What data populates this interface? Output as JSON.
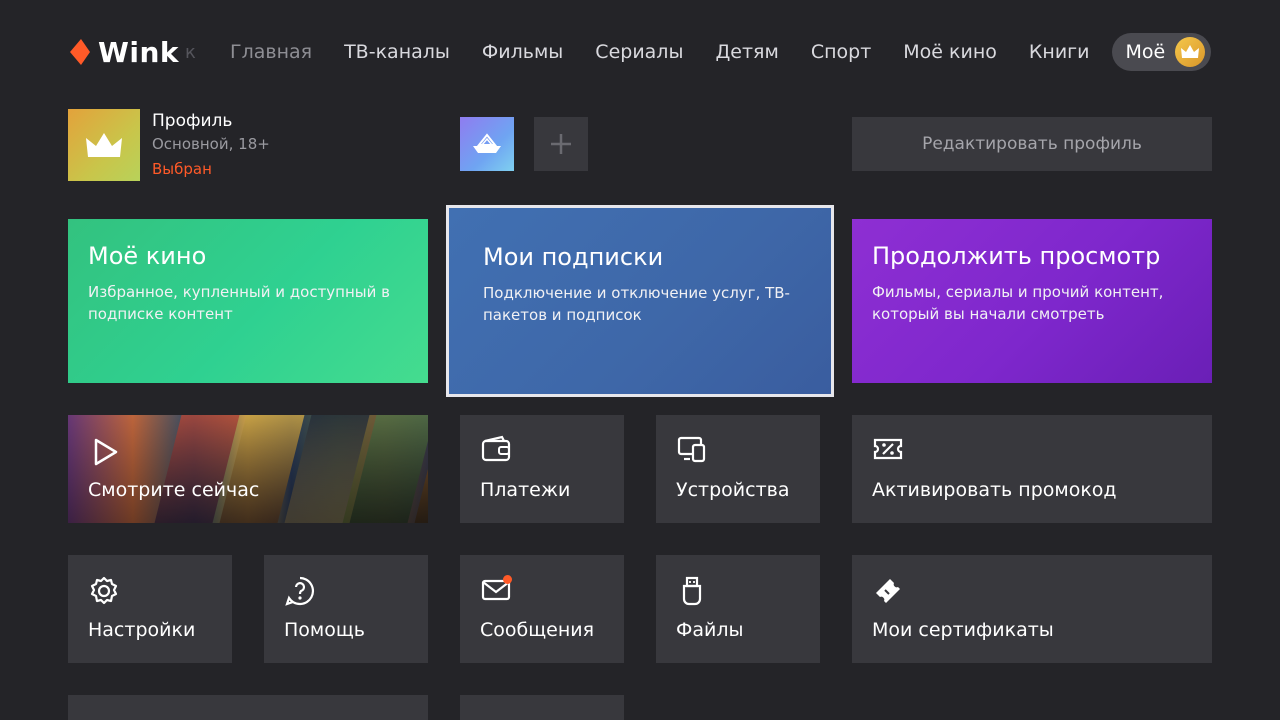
{
  "app": {
    "logo_text": "Wink",
    "logo_search_hint": "к"
  },
  "nav": {
    "items": [
      {
        "label": "Главная",
        "dim": true
      },
      {
        "label": "ТВ-каналы"
      },
      {
        "label": "Фильмы"
      },
      {
        "label": "Сериалы"
      },
      {
        "label": "Детям"
      },
      {
        "label": "Спорт"
      },
      {
        "label": "Моё кино"
      },
      {
        "label": "Книги"
      }
    ],
    "my_label": "Моё"
  },
  "profile": {
    "name": "Профиль",
    "sub": "Основной, 18+",
    "status": "Выбран",
    "edit_label": "Редактировать профиль"
  },
  "cards": {
    "kino": {
      "title": "Моё кино",
      "desc": "Избранное, купленный и доступный в подписке контент"
    },
    "subs": {
      "title": "Мои подписки",
      "desc": "Подключение и отключение услуг, ТВ-пакетов и подписок"
    },
    "cont": {
      "title": "Продолжить просмотр",
      "desc": "Фильмы, сериалы и прочий контент, который вы начали смотреть"
    }
  },
  "tiles": {
    "watch": "Смотрите сейчас",
    "payments": "Платежи",
    "devices": "Устройства",
    "promo": "Активировать промокод",
    "settings": "Настройки",
    "help": "Помощь",
    "messages": "Сообщения",
    "files": "Файлы",
    "certs": "Мои сертификаты"
  },
  "colors": {
    "background": "#242428",
    "tile": "#38383d",
    "accent": "#ff5a28",
    "kino": "#33c27f",
    "subs": "#4170b2",
    "cont": "#8e2fd3"
  }
}
